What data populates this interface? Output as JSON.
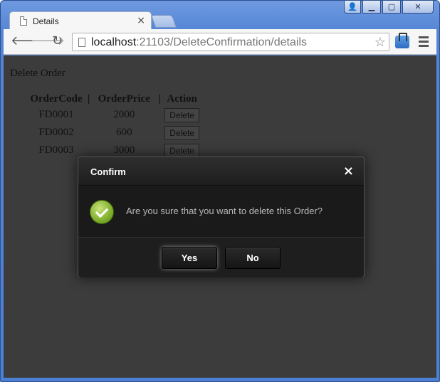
{
  "browser": {
    "tab_title": "Details",
    "tab_close": "×",
    "url_host": "localhost",
    "url_rest": ":21103/DeleteConfirmation/details"
  },
  "page": {
    "heading": "Delete Order",
    "columns": [
      "OrderCode",
      "OrderPrice",
      "Action"
    ],
    "separator": "|",
    "rows": [
      {
        "code": "FD0001",
        "price": "2000",
        "action": "Delete"
      },
      {
        "code": "FD0002",
        "price": "600",
        "action": "Delete"
      },
      {
        "code": "FD0003",
        "price": "3000",
        "action": "Delete"
      }
    ]
  },
  "modal": {
    "title": "Confirm",
    "close": "×",
    "message": "Are you sure that you want to delete this Order?",
    "yes_label": "Yes",
    "no_label": "No",
    "icon": "check-circle-icon",
    "icon_color": "#8fbf2f"
  }
}
